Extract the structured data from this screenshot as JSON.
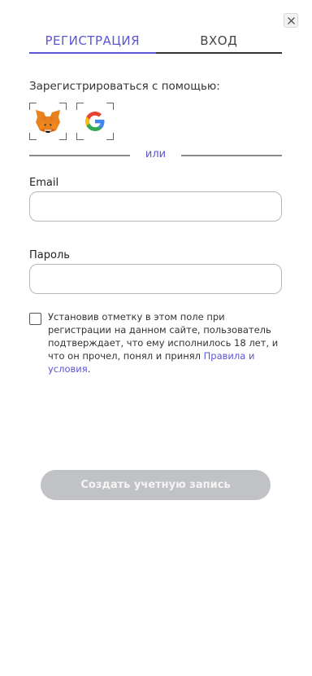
{
  "dialog": {
    "close_icon": "close-icon"
  },
  "tabs": {
    "register": "РЕГИСТРАЦИЯ",
    "login": "ВХОД",
    "active_color": "#5c56d6"
  },
  "social": {
    "title": "Зарегистрироваться с помощью:",
    "providers": [
      {
        "icon": "metamask-fox-icon"
      },
      {
        "icon": "google-g-icon"
      }
    ],
    "or_text": "или"
  },
  "form": {
    "email_label": "Email",
    "email_value": "",
    "password_label": "Пароль",
    "password_value": ""
  },
  "terms": {
    "checked": false,
    "text": "Установив отметку в этом поле при регистрации на данном сайте, пользователь подтверждает, что ему исполнилось 18 лет, и что он прочел, понял и принял ",
    "link_text": "Правила и условия",
    "suffix": "."
  },
  "submit": {
    "label": "Создать учетную запись",
    "enabled": false,
    "color": "#c0c2c5"
  }
}
